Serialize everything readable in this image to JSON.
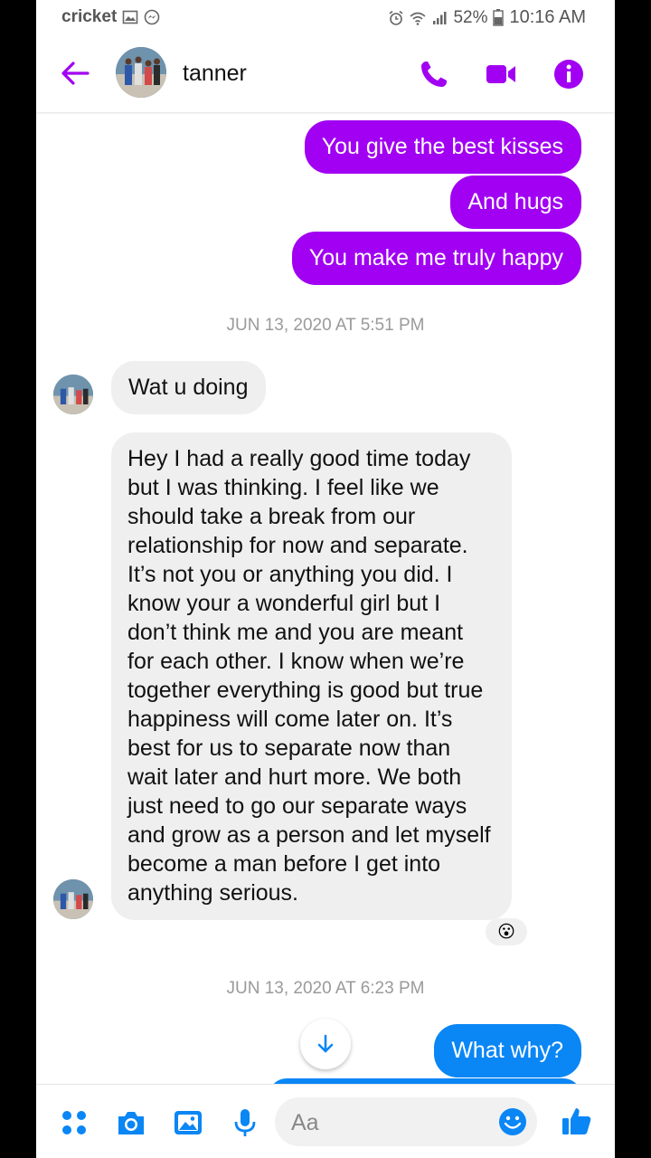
{
  "status_bar": {
    "carrier": "cricket",
    "battery": "52%",
    "time": "10:16 AM"
  },
  "header": {
    "contact_name": "tanner",
    "accent_color": "#a100f2"
  },
  "conversation": {
    "sent_group_1": [
      "You give the best kisses",
      "And hugs",
      "You make me truly happy"
    ],
    "timestamp_1": "JUN 13, 2020 AT 5:51 PM",
    "received_1": "Wat u doing",
    "received_2": "Hey I had a really good time today but I was thinking. I feel like we should take a break from our relationship for now and separate. It’s not you or anything you did. I know your a wonderful girl but I don’t think me and you are meant for each other. I know when we’re together everything is good but true happiness will come later on. It’s best for us to separate now than wait later and hurt more. We both just need to go our separate ways and grow as a person and let myself become a man before I get into anything serious.",
    "received_2_reaction": "😮",
    "timestamp_2": "JUN 13, 2020 AT 6:23 PM",
    "sent_2": "What why?"
  },
  "composer": {
    "placeholder": "Aa"
  },
  "icons": [
    "back-arrow-icon",
    "phone-icon",
    "video-camera-icon",
    "info-icon",
    "apps-icon",
    "camera-icon",
    "gallery-icon",
    "microphone-icon",
    "emoji-icon",
    "thumbs-up-icon",
    "scroll-down-arrow-icon"
  ]
}
